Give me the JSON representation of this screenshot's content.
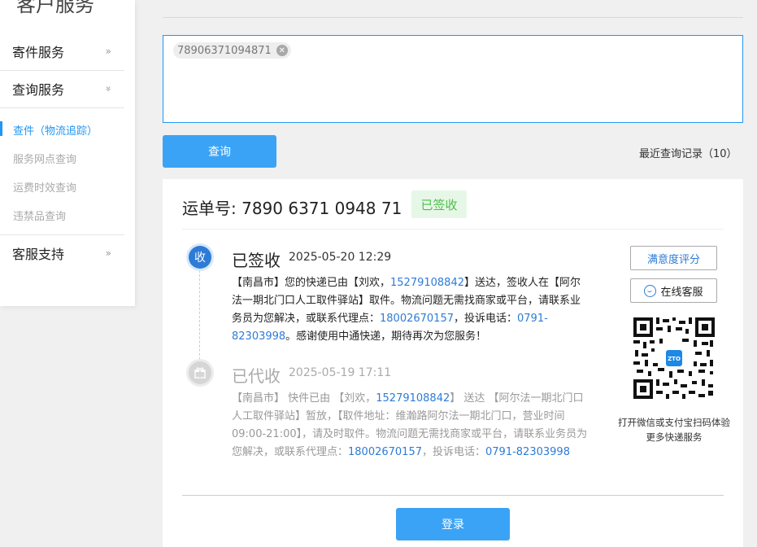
{
  "sidebar": {
    "title": "客户服务",
    "menu": [
      {
        "label": "寄件服务",
        "chevron": "»"
      },
      {
        "label": "查询服务",
        "chevron": "»"
      },
      {
        "label": "客服支持",
        "chevron": "»"
      }
    ],
    "sub_items": [
      {
        "label": "查件（物流追踪）",
        "active": true
      },
      {
        "label": "服务网点查询",
        "active": false
      },
      {
        "label": "运费时效查询",
        "active": false
      },
      {
        "label": "违禁品查询",
        "active": false
      }
    ]
  },
  "search": {
    "chip": "78906371094871",
    "chip_remove": "✕",
    "query_label": "查询",
    "recent_label": "最近查询记录（10）"
  },
  "result": {
    "waybill_label": "运单号: 7890 6371 0948 71",
    "status_badge": "已签收",
    "events": [
      {
        "icon_text": "收",
        "status": "已签收",
        "time": "2025-05-20 12:29",
        "desc_1": "【南昌市】您的快递已由【刘欢，",
        "phone_1": "15279108842",
        "desc_2": "】送达，签收人在【阿尔法一期北门口人工取件驿站】取件。物流问题无需找商家或平台，请联系业务员为您解决，或联系代理点：",
        "phone_2": "18002670157",
        "desc_3": "，投诉电话：",
        "phone_3": "0791-82303998",
        "desc_4": "。感谢使用中通快递，期待再次为您服务！"
      },
      {
        "icon_text": "",
        "status": "已代收",
        "time": "2025-05-19 17:11",
        "desc_1": "【南昌市】 快件已由 【刘欢，",
        "phone_1": "15279108842",
        "desc_2": "】 送达 【阿尔法一期北门口人工取件驿站】暂放，【取件地址：维瀚路阿尔法一期北门口，营业时间09:00-21:00】，请及时取件。物流问题无需找商家或平台，请联系业务员为您解决，或联系代理点：",
        "phone_2": "18002670157",
        "desc_3": "，投诉电话：",
        "phone_3": "0791-82303998",
        "desc_4": ""
      }
    ],
    "rate_label": "满意度评分",
    "service_label": "在线客服",
    "qr_caption": "打开微信或支付宝扫码体验更多快递服务",
    "qr_logo": "ZTO",
    "login_label": "登录"
  },
  "colors": {
    "accent": "#3ba3f5",
    "link": "#2e7bd6",
    "success_bg": "#e7f7e7",
    "success_text": "#4cbf4c"
  }
}
